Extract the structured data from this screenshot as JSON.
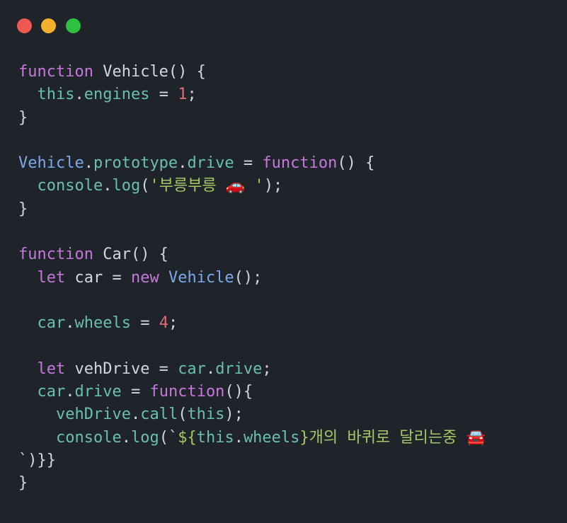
{
  "colors": {
    "background": "#1e242a",
    "close": "#ee5a52",
    "minimize": "#f2b02d",
    "maximize": "#2cc23f",
    "keyword": "#c678dd",
    "function_name": "#e5e7eb",
    "identifier": "#7fa8ea",
    "property": "#6bbfae",
    "number": "#e06c75",
    "string": "#a6c864",
    "punctuation": "#d4d7dd",
    "this": "#6bbfae"
  },
  "window_controls": [
    "close-icon",
    "minimize-icon",
    "maximize-icon"
  ],
  "code_lines": [
    [
      {
        "t": "function",
        "c": "keyword"
      },
      {
        "t": " Vehicle() {",
        "c": "plain"
      }
    ],
    [
      {
        "t": "  this",
        "c": "this"
      },
      {
        "t": ".",
        "c": "plain"
      },
      {
        "t": "engines",
        "c": "property"
      },
      {
        "t": " = ",
        "c": "plain"
      },
      {
        "t": "1",
        "c": "number"
      },
      {
        "t": ";",
        "c": "plain"
      }
    ],
    [
      {
        "t": "}",
        "c": "plain"
      }
    ],
    [],
    [
      {
        "t": "Vehicle",
        "c": "identifier"
      },
      {
        "t": ".",
        "c": "plain"
      },
      {
        "t": "prototype",
        "c": "property"
      },
      {
        "t": ".",
        "c": "plain"
      },
      {
        "t": "drive",
        "c": "property"
      },
      {
        "t": " = ",
        "c": "plain"
      },
      {
        "t": "function",
        "c": "keyword"
      },
      {
        "t": "() {",
        "c": "plain"
      }
    ],
    [
      {
        "t": "  console",
        "c": "property"
      },
      {
        "t": ".",
        "c": "plain"
      },
      {
        "t": "log",
        "c": "property"
      },
      {
        "t": "(",
        "c": "plain"
      },
      {
        "t": "'부릉부릉 🚗 '",
        "c": "string"
      },
      {
        "t": ");",
        "c": "plain"
      }
    ],
    [
      {
        "t": "}",
        "c": "plain"
      }
    ],
    [],
    [
      {
        "t": "function",
        "c": "keyword"
      },
      {
        "t": " Car() {",
        "c": "plain"
      }
    ],
    [
      {
        "t": "  let",
        "c": "keyword"
      },
      {
        "t": " car = ",
        "c": "plain"
      },
      {
        "t": "new",
        "c": "keyword"
      },
      {
        "t": " ",
        "c": "plain"
      },
      {
        "t": "Vehicle",
        "c": "identifier"
      },
      {
        "t": "();",
        "c": "plain"
      }
    ],
    [],
    [
      {
        "t": "  car",
        "c": "property"
      },
      {
        "t": ".",
        "c": "plain"
      },
      {
        "t": "wheels",
        "c": "property"
      },
      {
        "t": " = ",
        "c": "plain"
      },
      {
        "t": "4",
        "c": "number"
      },
      {
        "t": ";",
        "c": "plain"
      }
    ],
    [],
    [
      {
        "t": "  let",
        "c": "keyword"
      },
      {
        "t": " vehDrive = ",
        "c": "plain"
      },
      {
        "t": "car",
        "c": "property"
      },
      {
        "t": ".",
        "c": "plain"
      },
      {
        "t": "drive",
        "c": "property"
      },
      {
        "t": ";",
        "c": "plain"
      }
    ],
    [
      {
        "t": "  car",
        "c": "property"
      },
      {
        "t": ".",
        "c": "plain"
      },
      {
        "t": "drive",
        "c": "property"
      },
      {
        "t": " = ",
        "c": "plain"
      },
      {
        "t": "function",
        "c": "keyword"
      },
      {
        "t": "(){",
        "c": "plain"
      }
    ],
    [
      {
        "t": "    vehDrive",
        "c": "property"
      },
      {
        "t": ".",
        "c": "plain"
      },
      {
        "t": "call",
        "c": "property"
      },
      {
        "t": "(",
        "c": "plain"
      },
      {
        "t": "this",
        "c": "this"
      },
      {
        "t": ");",
        "c": "plain"
      }
    ],
    [
      {
        "t": "    console",
        "c": "property"
      },
      {
        "t": ".",
        "c": "plain"
      },
      {
        "t": "log",
        "c": "property"
      },
      {
        "t": "(`",
        "c": "plain"
      },
      {
        "t": "${",
        "c": "string"
      },
      {
        "t": "this",
        "c": "this"
      },
      {
        "t": ".",
        "c": "plain"
      },
      {
        "t": "wheels",
        "c": "property"
      },
      {
        "t": "}",
        "c": "string"
      },
      {
        "t": "개의 바퀴로 달리는중 🚘",
        "c": "string"
      }
    ],
    [
      {
        "t": "`)}",
        "c": "plain"
      },
      {
        "t": "}",
        "c": "plain"
      }
    ],
    [
      {
        "t": "}",
        "c": "plain"
      }
    ]
  ]
}
